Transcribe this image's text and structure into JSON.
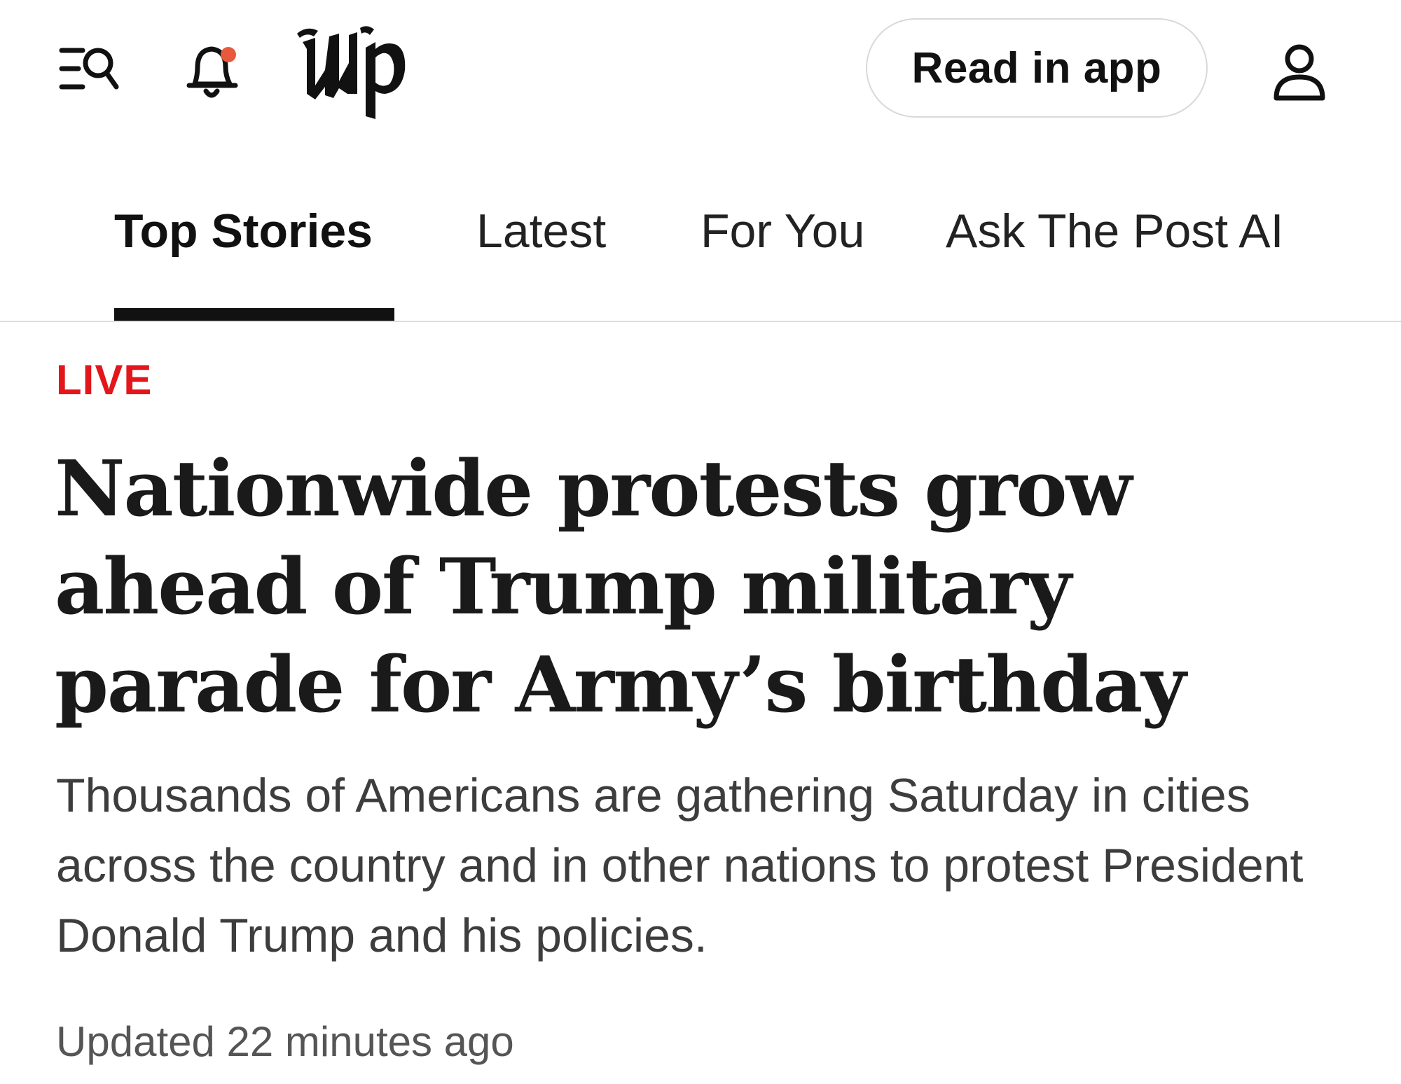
{
  "header": {
    "menu_search_icon": "menu-search-icon",
    "notification_icon": "bell-icon",
    "notification_dot_color": "#e85a3c",
    "logo_text": "wp",
    "read_in_app_label": "Read in app",
    "account_icon": "user-icon"
  },
  "tabs": [
    {
      "label": "Top Stories",
      "active": true
    },
    {
      "label": "Latest",
      "active": false
    },
    {
      "label": "For You",
      "active": false
    },
    {
      "label": "Ask The Post AI",
      "active": false
    }
  ],
  "article": {
    "tag": "LIVE",
    "tag_color": "#e3161b",
    "headline": "Nationwide protests grow ahead of Trump military parade for Army’s birthday",
    "dek": "Thousands of Americans are gathering Saturday in cities across the country and in  other nations to protest President Donald Trump and his policies.",
    "updated": "Updated 22 minutes ago"
  }
}
